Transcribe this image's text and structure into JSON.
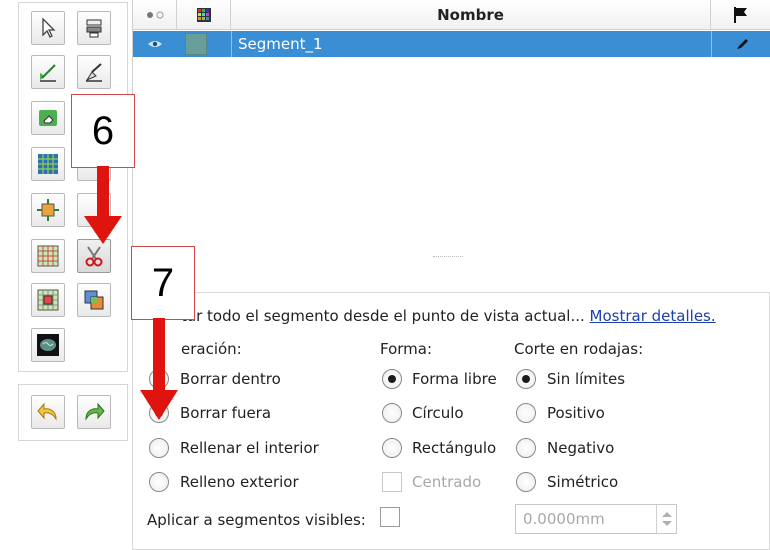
{
  "table": {
    "header": {
      "name_label": "Nombre"
    },
    "segments": [
      {
        "name": "Segment_1",
        "color": "#6a9e9b"
      }
    ]
  },
  "options": {
    "description": "tar todo el segmento desde el punto de vista actual...",
    "details_link": "Mostrar detalles.",
    "operation": {
      "label": "eración:",
      "options": [
        "Borrar dentro",
        "Borrar fuera",
        "Rellenar el interior",
        "Relleno exterior"
      ],
      "selected": "Borrar fuera"
    },
    "shape": {
      "label": "Forma:",
      "options": [
        "Forma libre",
        "Círculo",
        "Rectángulo"
      ],
      "selected": "Forma libre",
      "centered_label": "Centrado"
    },
    "slice_cut": {
      "label": "Corte en rodajas:",
      "options": [
        "Sin límites",
        "Positivo",
        "Negativo",
        "Simétrico"
      ],
      "selected": "Sin límites"
    },
    "apply_visible_label": "Aplicar a segmentos visibles:",
    "thickness_value": "0.0000mm"
  },
  "annotations": {
    "step_6": "6",
    "step_7": "7"
  },
  "colors": {
    "selection": "#3a8fd4",
    "callout_arrow": "#e0140e",
    "link": "#1b3fb0"
  }
}
